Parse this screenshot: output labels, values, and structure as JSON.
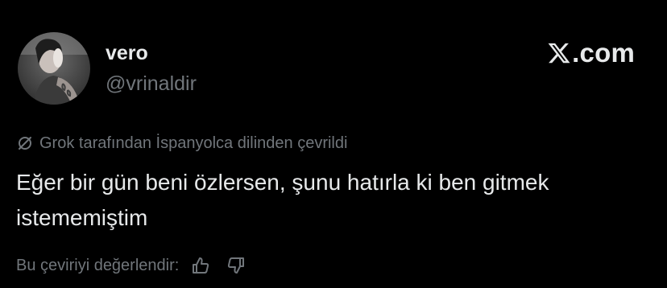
{
  "author": {
    "display_name": "vero",
    "handle": "@vrinaldir",
    "avatar_icon": "profile-photo"
  },
  "brand": {
    "label": ".com",
    "icon": "x-logo-icon"
  },
  "translation": {
    "note": "Grok tarafından İspanyolca dilinden çevrildi",
    "icon": "translate-slash-icon"
  },
  "tweet": {
    "text": "Eğer bir gün beni özlersen, şunu hatırla ki ben gitmek istememiştim"
  },
  "feedback": {
    "label": "Bu çeviriyi değerlendir:",
    "thumbs_up_icon": "thumbs-up-icon",
    "thumbs_down_icon": "thumbs-down-icon"
  },
  "colors": {
    "background": "#000000",
    "primary_text": "#e7e9ea",
    "secondary_text": "#71767b"
  }
}
